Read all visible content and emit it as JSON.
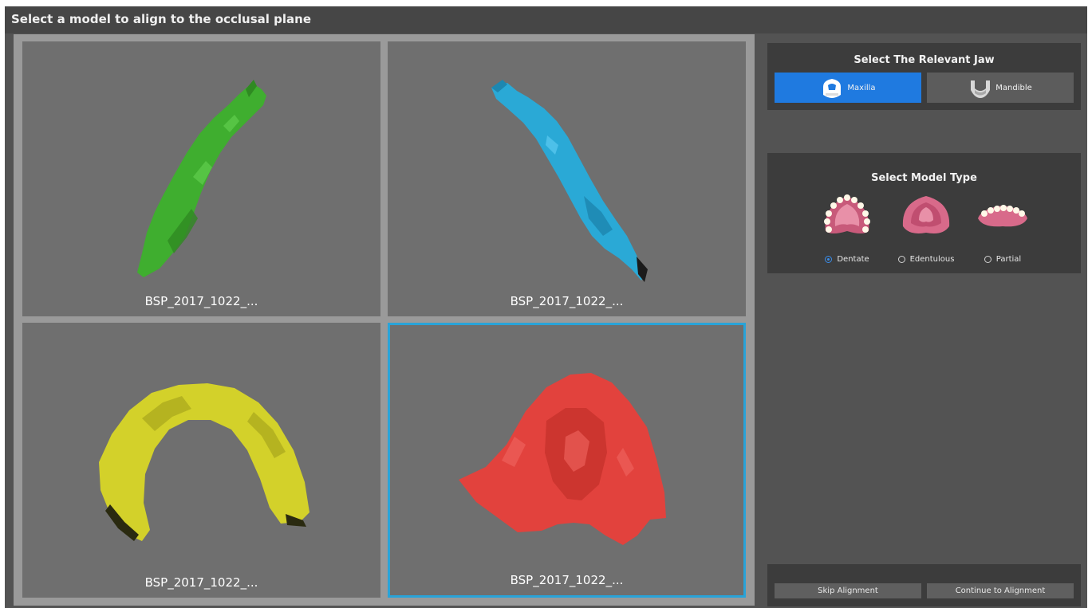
{
  "title": "Select a model to align to the occlusal plane",
  "models": [
    {
      "label": "BSP_2017_1022_...",
      "color": "#3fae2f"
    },
    {
      "label": "BSP_2017_1022_...",
      "color": "#2aa9d6"
    },
    {
      "label": "BSP_2017_1022_...",
      "color": "#d3d12a"
    },
    {
      "label": "BSP_2017_1022_...",
      "color": "#e2423d"
    }
  ],
  "selected_model_index": 3,
  "jaw_panel": {
    "title": "Select The Relevant Jaw",
    "maxilla_label": "Maxilla",
    "mandible_label": "Mandible",
    "selected": "Maxilla"
  },
  "model_type_panel": {
    "title": "Select Model Type",
    "options": [
      {
        "label": "Dentate",
        "icon": "dentate-arch-icon",
        "checked": true
      },
      {
        "label": "Edentulous",
        "icon": "edentulous-arch-icon",
        "checked": false
      },
      {
        "label": "Partial",
        "icon": "partial-arch-icon",
        "checked": false
      }
    ]
  },
  "footer": {
    "skip_label": "Skip Alignment",
    "continue_label": "Continue to Alignment"
  },
  "colors": {
    "accent": "#1f7ae0",
    "selection": "#29a3d8"
  }
}
